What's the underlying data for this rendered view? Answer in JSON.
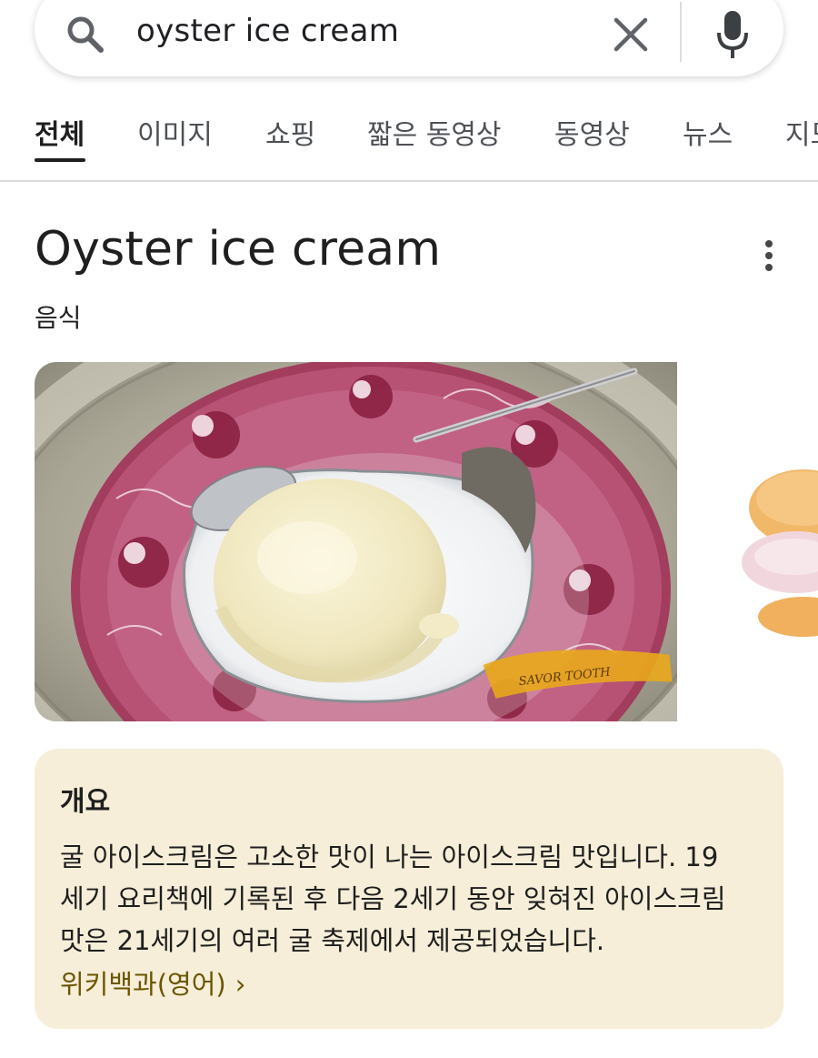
{
  "search": {
    "query": "oyster ice cream"
  },
  "tabs": [
    {
      "label": "전체",
      "active": true
    },
    {
      "label": "이미지"
    },
    {
      "label": "쇼핑"
    },
    {
      "label": "짧은 동영상"
    },
    {
      "label": "동영상"
    },
    {
      "label": "뉴스"
    },
    {
      "label": "지도"
    }
  ],
  "entity": {
    "title": "Oyster ice cream",
    "subtitle": "음식"
  },
  "images": {
    "main_watermark": "SAVOR TOOTH"
  },
  "overview": {
    "heading": "개요",
    "lines": [
      "굴 아이스크림은 고소한 맛이 나는 아이스크림 맛입니다. 19",
      "세기 요리책에 기록된 후 다음 2세기 동안 잊혀진 아이스크림",
      "맛은 21세기의 여러 굴 축제에서 제공되었습니다."
    ],
    "source": "위키백과(영어)",
    "source_chevron": "›"
  },
  "colors": {
    "card_bg": "#f6eed8",
    "link": "#6b5600",
    "plate_pink": "#b24a6c",
    "ice_cream": "#f2ecc9"
  },
  "icons": [
    "search-icon",
    "close-icon",
    "mic-icon",
    "more-vert-icon",
    "chevron-right-icon"
  ]
}
